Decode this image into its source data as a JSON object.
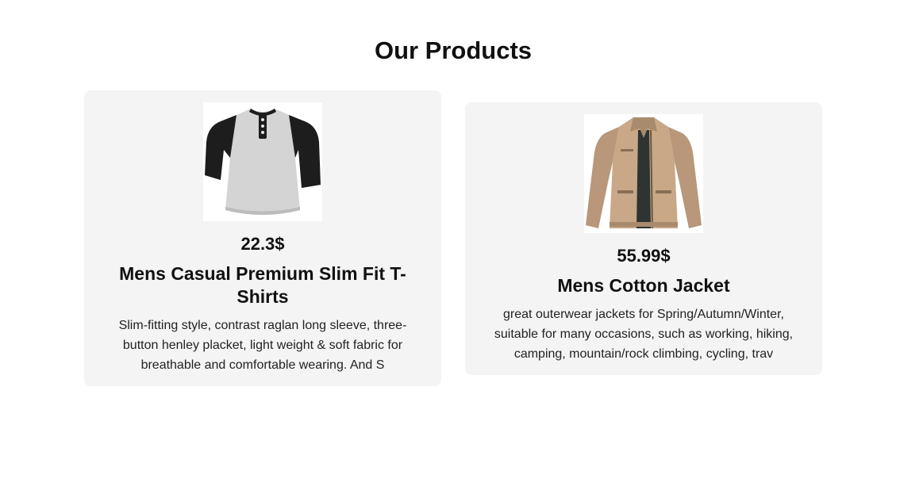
{
  "page": {
    "title": "Our Products"
  },
  "products": [
    {
      "price": "22.3$",
      "name": "Mens Casual Premium Slim Fit T-Shirts",
      "description": "Slim-fitting style, contrast raglan long sleeve, three-button henley placket, light weight & soft fabric for breathable and comfortable wearing. And S",
      "image_icon": "raglan-henley-shirt-image"
    },
    {
      "price": "55.99$",
      "name": "Mens Cotton Jacket",
      "description": "great outerwear jackets for Spring/Autumn/Winter, suitable for many occasions, such as working, hiking, camping, mountain/rock climbing, cycling, trav",
      "image_icon": "khaki-cotton-jacket-image"
    }
  ],
  "colors": {
    "card_background": "#f4f4f4",
    "page_background": "#ffffff",
    "text": "#111111"
  }
}
